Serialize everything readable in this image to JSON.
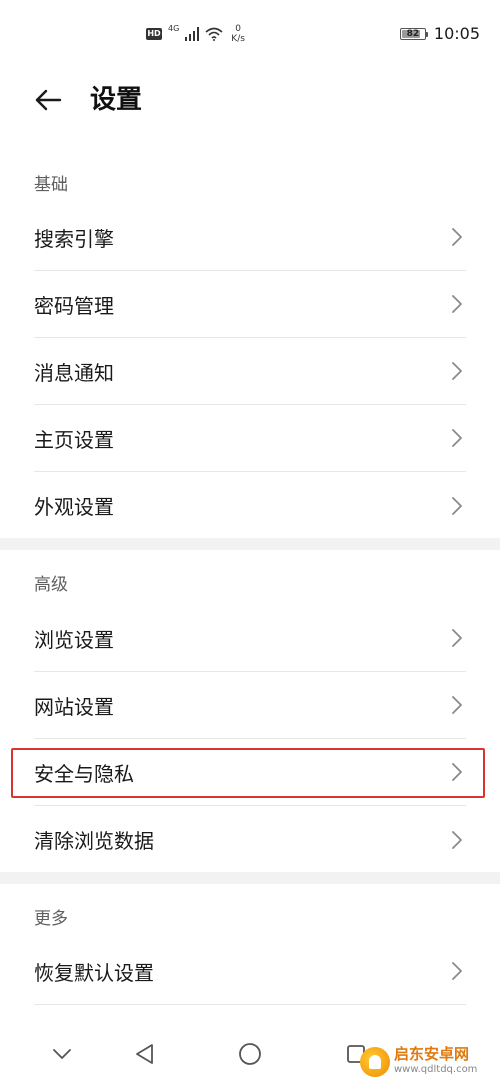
{
  "status_bar": {
    "hd": "HD",
    "network": "4G",
    "netspeed_value": "0",
    "netspeed_unit": "K/s",
    "battery": "82",
    "battery_level": 82,
    "time": "10:05"
  },
  "header": {
    "title": "设置"
  },
  "sections": [
    {
      "label": "基础",
      "items": [
        "搜索引擎",
        "密码管理",
        "消息通知",
        "主页设置",
        "外观设置"
      ]
    },
    {
      "label": "高级",
      "items": [
        "浏览设置",
        "网站设置",
        "安全与隐私",
        "清除浏览数据"
      ]
    },
    {
      "label": "更多",
      "items": [
        "恢复默认设置"
      ]
    }
  ],
  "highlighted_item": "安全与隐私",
  "watermark": {
    "name": "启东安卓网",
    "url": "www.qdltdq.com"
  },
  "colors": {
    "highlight": "#d9342f",
    "separator": "#e6e6e6",
    "group_gap": "#f2f2f2"
  }
}
